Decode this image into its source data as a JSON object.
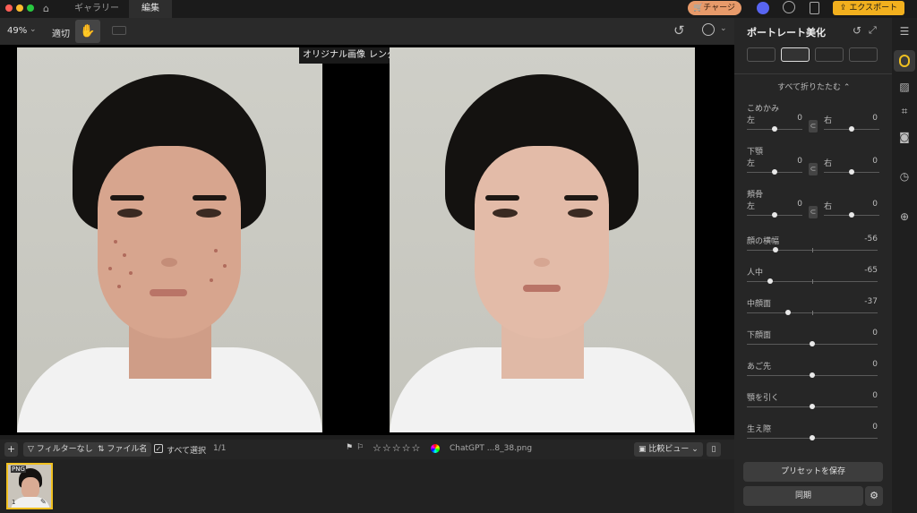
{
  "titlebar": {
    "tabs": [
      {
        "label": "ギャラリー"
      },
      {
        "label": "編集"
      }
    ],
    "charge_label": "チャージ",
    "export_label": "エクスポート",
    "colors": {
      "charge_bg": "#e79a6a",
      "export_bg": "#f2b01e"
    }
  },
  "toolbar": {
    "zoom": "49%",
    "fit_label": "適切"
  },
  "canvas": {
    "left_label": "オリジナル画像",
    "right_label": "レンダリング"
  },
  "filterbar": {
    "filter_label": "フィルターなし",
    "sort_label": "ファイル名",
    "select_all_label": "すべて選択",
    "count": "1/1",
    "stars": "☆☆☆☆☆",
    "filename": "ChatGPT ...8_38.png",
    "compare_view_label": "比較ビュー"
  },
  "filmstrip": {
    "thumb_badge": "PNG",
    "thumb_index": "1"
  },
  "panel": {
    "title": "ポートレート美化",
    "collapse_label": "すべて折りたたむ",
    "pair_groups": [
      {
        "name": "こめかみ",
        "left_label": "左",
        "left_value": "0",
        "right_label": "右",
        "right_value": "0"
      },
      {
        "name": "下顎",
        "left_label": "左",
        "left_value": "0",
        "right_label": "右",
        "right_value": "0"
      },
      {
        "name": "頬骨",
        "left_label": "左",
        "left_value": "0",
        "right_label": "右",
        "right_value": "0"
      }
    ],
    "sliders": [
      {
        "name": "顔の横幅",
        "value": "-56"
      },
      {
        "name": "人中",
        "value": "-65"
      },
      {
        "name": "中顔面",
        "value": "-37"
      },
      {
        "name": "下顔面",
        "value": "0"
      },
      {
        "name": "あご先",
        "value": "0"
      },
      {
        "name": "顎を引く",
        "value": "0"
      },
      {
        "name": "生え際",
        "value": "0"
      }
    ],
    "save_preset_label": "プリセットを保存",
    "sync_label": "同期",
    "accent_color": "#f0c020"
  }
}
